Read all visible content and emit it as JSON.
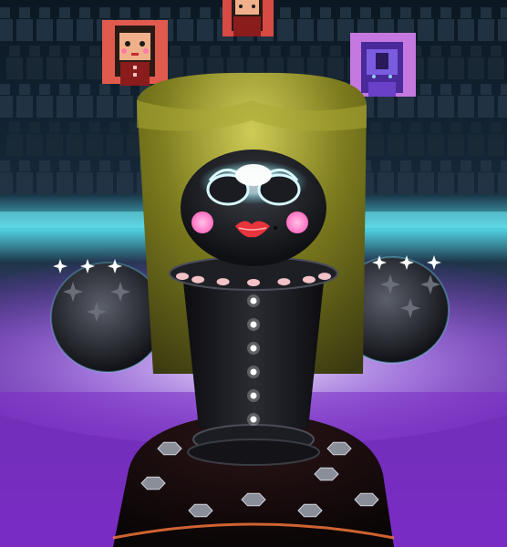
{
  "scene": {
    "type": "3d-game-viewport",
    "subject": "doll-boss-character",
    "colors": {
      "background_dark": "#0b1822",
      "crowd": "#1b2a36",
      "cyan_glow": "#6fe6f0",
      "floor_purple": "#7a2cc4",
      "floor_glow": "#d8b8ff",
      "hair_olive": "#7d7c1e",
      "body_black": "#151519",
      "blush_pink": "#ff8fd0",
      "lips_red": "#e8343c",
      "skirt_red": "#8a1c1c",
      "rivet_pink": "#f2c2c6",
      "spectator_card_red": "#e05a4e",
      "spectator_card_violet": "#c478e0"
    }
  },
  "spectators": [
    {
      "name": "spectator-left",
      "card_color": "#e05a4e"
    },
    {
      "name": "spectator-center",
      "card_color": "#d84a44"
    },
    {
      "name": "spectator-right",
      "card_color": "#c478e0"
    }
  ],
  "shuriken_sets": [
    {
      "name": "left-shuriken-set",
      "count": 3
    },
    {
      "name": "right-shuriken-set",
      "count": 3
    }
  ],
  "body_lights": {
    "count": 6
  }
}
